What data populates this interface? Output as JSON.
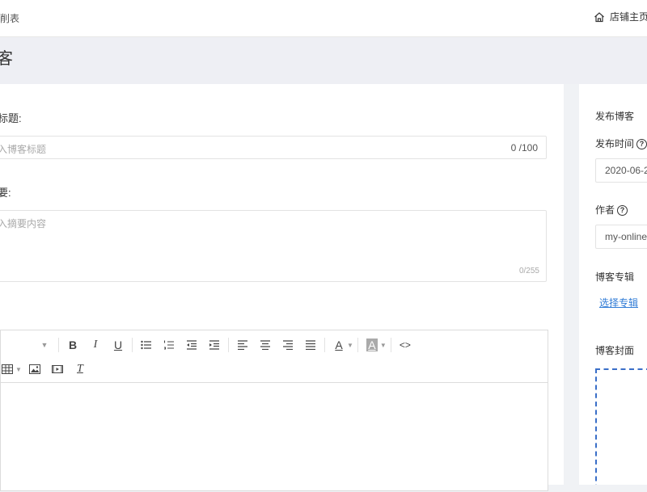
{
  "topbar": {
    "breadcrumb": "削表",
    "home_label": "店铺主页"
  },
  "page": {
    "title": "客"
  },
  "form": {
    "title_label": "标题:",
    "title_placeholder": "入博客标题",
    "title_count": "0 /100",
    "summary_label": "要:",
    "summary_placeholder": "入摘要内容",
    "summary_count": "0/255"
  },
  "editor": {
    "toolbar_icons": [
      "caret-down-icon",
      "bold-icon",
      "italic-icon",
      "underline-icon",
      "bullet-list-icon",
      "numbered-list-icon",
      "outdent-icon",
      "indent-icon",
      "align-left-icon",
      "align-center-icon",
      "align-right-icon",
      "align-justify-icon",
      "font-color-icon",
      "bg-color-icon",
      "code-icon",
      "table-icon",
      "image-icon",
      "video-icon",
      "clear-format-icon"
    ],
    "bold": "B",
    "italic": "I",
    "underline": "U",
    "font_color": "A",
    "bg_color": "A",
    "code": "<>",
    "clear_format": "T"
  },
  "sidebar": {
    "publish_title": "发布博客",
    "publish_time_label": "发布时间",
    "publish_time_value": "2020-06-2",
    "author_label": "作者",
    "author_value": "my-online",
    "column_label": "博客专辑",
    "select_column_link": "选择专辑",
    "cover_label": "博客封面"
  },
  "colors": {
    "accent": "#2f7bd6",
    "page_bg": "#f0f2f5",
    "dashed_border": "#3a6fc8"
  }
}
